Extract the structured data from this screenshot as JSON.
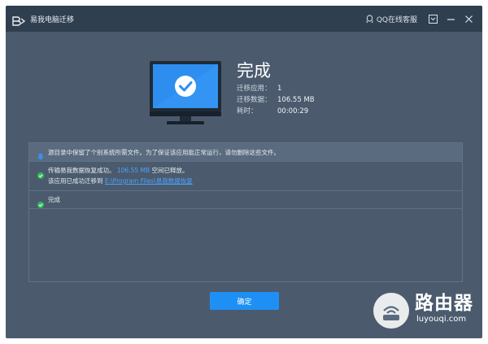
{
  "app": {
    "title": "易我电脑迁移"
  },
  "titlebar": {
    "support_label": "QQ在线客服"
  },
  "result": {
    "heading": "完成",
    "stats": [
      {
        "label": "迁移应用：",
        "value": "1"
      },
      {
        "label": "迁移数据：",
        "value": "106.55 MB"
      },
      {
        "label": "耗时：",
        "value": "00:00:29"
      }
    ]
  },
  "log": {
    "warning": "源目录中保留了个别系统所需文件。为了保证该应用能正常运行，请勿删除这些文件。",
    "entry1": {
      "prefix": "传输易我数据恢复成功。",
      "size": "106.55 MB",
      "suffix": " 空间已释放。",
      "line2_prefix": "该应用已成功迁移到 ",
      "path": "E:\\Program Files\\易我数据恢复"
    },
    "entry2": "完成"
  },
  "buttons": {
    "confirm": "确定"
  },
  "watermark": {
    "title": "路由器",
    "url": "luyouqi.com"
  },
  "colors": {
    "accent": "#1e90f5",
    "success": "#2ebd59",
    "info": "#3b8ff0",
    "window_bg": "#4b5b6d"
  }
}
